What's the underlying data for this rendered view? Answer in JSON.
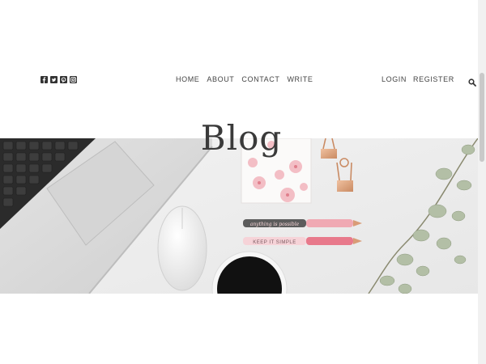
{
  "social": {
    "icons": [
      "facebook-icon",
      "twitter-icon",
      "pinterest-icon",
      "instagram-icon"
    ]
  },
  "nav": {
    "center": [
      "HOME",
      "ABOUT",
      "CONTACT",
      "WRITE"
    ],
    "right": [
      "LOGIN",
      "REGISTER"
    ]
  },
  "hero": {
    "title": "Blog",
    "pen_1_text": "anything is possible",
    "pen_2_text": "KEEP IT SIMPLE"
  },
  "colors": {
    "text": "#444444",
    "hero_bg": "#ececec",
    "pink_accent": "#f0a9b3",
    "rose_gold": "#d99c77"
  }
}
